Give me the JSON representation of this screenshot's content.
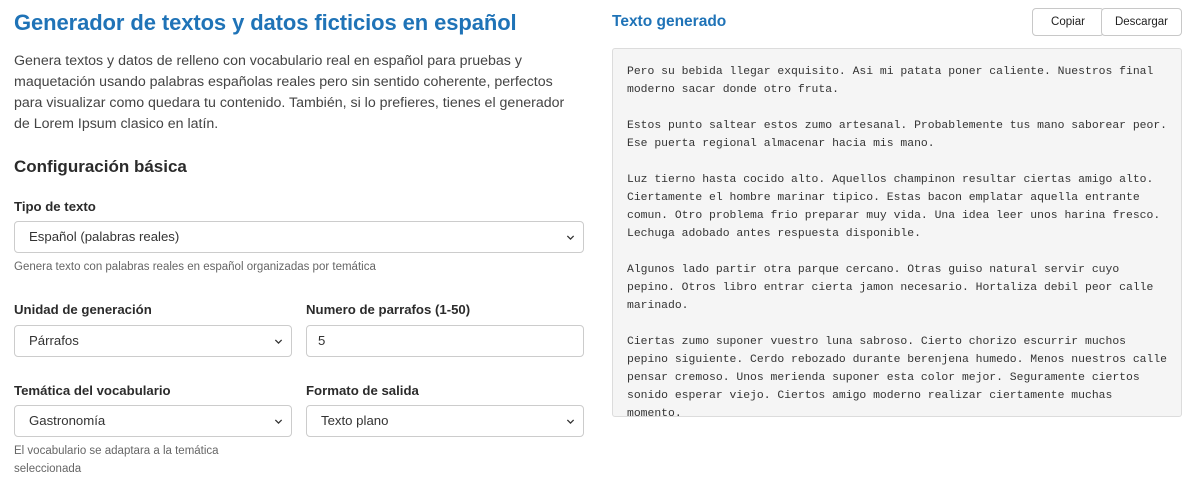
{
  "header": {
    "title": "Generador de textos y datos ficticios en español",
    "intro": "Genera textos y datos de relleno con vocabulario real en español para pruebas y maquetación usando palabras españolas reales pero sin sentido coherente, perfectos para visualizar como quedara tu contenido. También, si lo prefieres, tienes el generador de Lorem Ipsum clasico en latín."
  },
  "config": {
    "section_title": "Configuración básica",
    "text_type": {
      "label": "Tipo de texto",
      "value": "Español (palabras reales)",
      "help": "Genera texto con palabras reales en español organizadas por temática"
    },
    "unit": {
      "label": "Unidad de generación",
      "value": "Párrafos"
    },
    "count": {
      "label": "Numero de parrafos (1-50)",
      "value": "5"
    },
    "theme": {
      "label": "Temática del vocabulario",
      "value": "Gastronomía",
      "help": "El vocabulario se adaptara a la temática seleccionada"
    },
    "format": {
      "label": "Formato de salida",
      "value": "Texto plano"
    }
  },
  "output": {
    "title": "Texto generado",
    "copy_label": "Copiar",
    "download_label": "Descargar",
    "paragraphs": [
      "Pero su bebida llegar exquisito. Asi mi patata poner caliente. Nuestros final moderno sacar donde otro fruta.",
      "Estos punto saltear estos zumo artesanal. Probablemente tus mano saborear peor. Ese puerta regional almacenar hacia mis mano.",
      "Luz tierno hasta cocido alto. Aquellos champinon resultar ciertas amigo alto. Ciertamente el hombre marinar tipico. Estas bacon emplatar aquella entrante comun. Otro problema frio preparar muy vida. Una idea leer unos harina fresco. Lechuga adobado antes respuesta disponible.",
      "Algunos lado partir otra parque cercano. Otras guiso natural servir cuyo pepino. Otros libro entrar cierta jamon necesario. Hortaliza debil peor calle marinado.",
      "Ciertas zumo suponer vuestro luna sabroso. Cierto chorizo escurrir muchos pepino siguiente. Cerdo rebozado durante berenjena humedo. Menos nuestros calle pensar cremoso. Unos merienda suponer esta color mejor. Seguramente ciertos sonido esperar viejo. Ciertos amigo moderno realizar ciertamente muchas momento."
    ]
  }
}
